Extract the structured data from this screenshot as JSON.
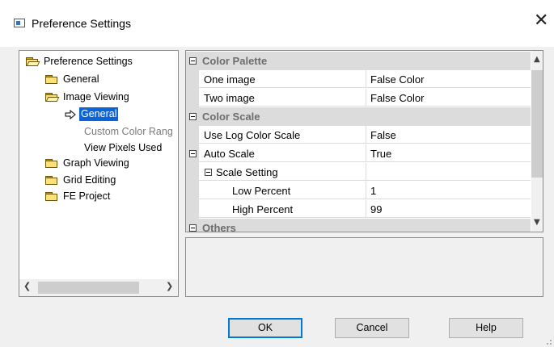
{
  "window": {
    "title": "Preference Settings",
    "close_symbol": "✕"
  },
  "tree": {
    "root": "Preference Settings",
    "items": {
      "general": "General",
      "image_viewing": "Image Viewing",
      "iv_general": "General",
      "custom_color": "Custom Color Rang",
      "view_pixels": "View Pixels Used",
      "graph_viewing": "Graph Viewing",
      "grid_editing": "Grid Editing",
      "fe_project": "FE Project"
    },
    "selected": "Image Viewing > General"
  },
  "grid": {
    "cat_color_palette": "Color Palette",
    "one_image": {
      "name": "One image",
      "value": "False Color"
    },
    "two_image": {
      "name": "Two image",
      "value": "False Color"
    },
    "cat_color_scale": "Color Scale",
    "use_log": {
      "name": "Use Log Color Scale",
      "value": "False"
    },
    "auto_scale": {
      "name": "Auto Scale",
      "value": "True"
    },
    "scale_setting": {
      "name": "Scale Setting",
      "value": ""
    },
    "low_percent": {
      "name": "Low Percent",
      "value": "1"
    },
    "high_percent": {
      "name": "High Percent",
      "value": "99"
    },
    "cat_others": "Others"
  },
  "buttons": {
    "ok": "OK",
    "cancel": "Cancel",
    "help": "Help"
  },
  "colors": {
    "selection": "#0a64d8",
    "category_bg": "#dcdcdc",
    "default_button_border": "#0078d7"
  }
}
